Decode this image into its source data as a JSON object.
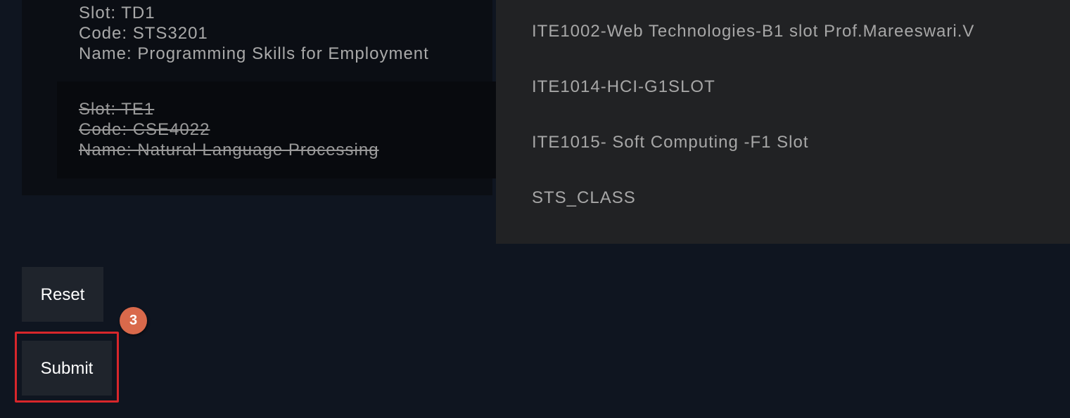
{
  "registered_courses": [
    {
      "slot": "Slot: TD1",
      "code": "Code: STS3201",
      "name": "Name: Programming Skills for Employment",
      "dropped": false
    },
    {
      "slot": "Slot: TE1",
      "code": "Code: CSE4022",
      "name": "Name: Natural Language Processing",
      "dropped": true
    }
  ],
  "class_list": [
    "ITE1002-Web Technologies-B1 slot Prof.Mareeswari.V",
    "ITE1014-HCI-G1SLOT",
    "ITE1015- Soft Computing -F1 Slot",
    "STS_CLASS"
  ],
  "buttons": {
    "reset": "Reset",
    "submit": "Submit"
  },
  "annotation": {
    "step": "3",
    "badge_color": "#d9694b",
    "highlight_color": "#d8262b"
  },
  "colors": {
    "page_bg": "#0f1520",
    "left_panel_bg": "#0b0e14",
    "right_panel_bg": "#212224",
    "button_bg": "#1f242c"
  }
}
